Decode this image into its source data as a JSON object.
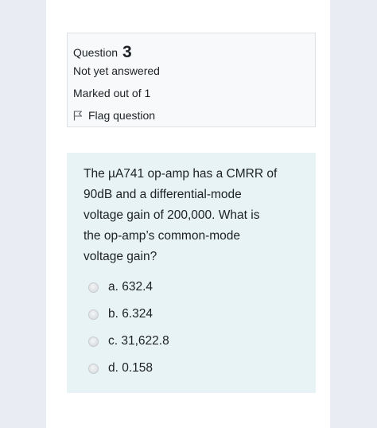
{
  "colors": {
    "page_background": "#e9edf3",
    "info_card_background": "#f8f9fa",
    "question_card_background": "#e7f3f5",
    "text": "#1d2125"
  },
  "question_info": {
    "label": "Question",
    "number": "3",
    "state": "Not yet answered",
    "marks": "Marked out of 1",
    "flag_icon": "flag-icon",
    "flag_label": "Flag question"
  },
  "question": {
    "line1": "The µA741 op-amp has a CMRR of",
    "line2": "90dB and a differential-mode",
    "line3": "voltage gain of 200,000. What is",
    "line4": "the op-amp’s common-mode",
    "line5": "voltage gain?",
    "answers": [
      {
        "label": "a. 632.4",
        "selected": false
      },
      {
        "label": "b. 6.324",
        "selected": false
      },
      {
        "label": "c. 31,622.8",
        "selected": false
      },
      {
        "label": "d. 0.158",
        "selected": false
      }
    ]
  }
}
